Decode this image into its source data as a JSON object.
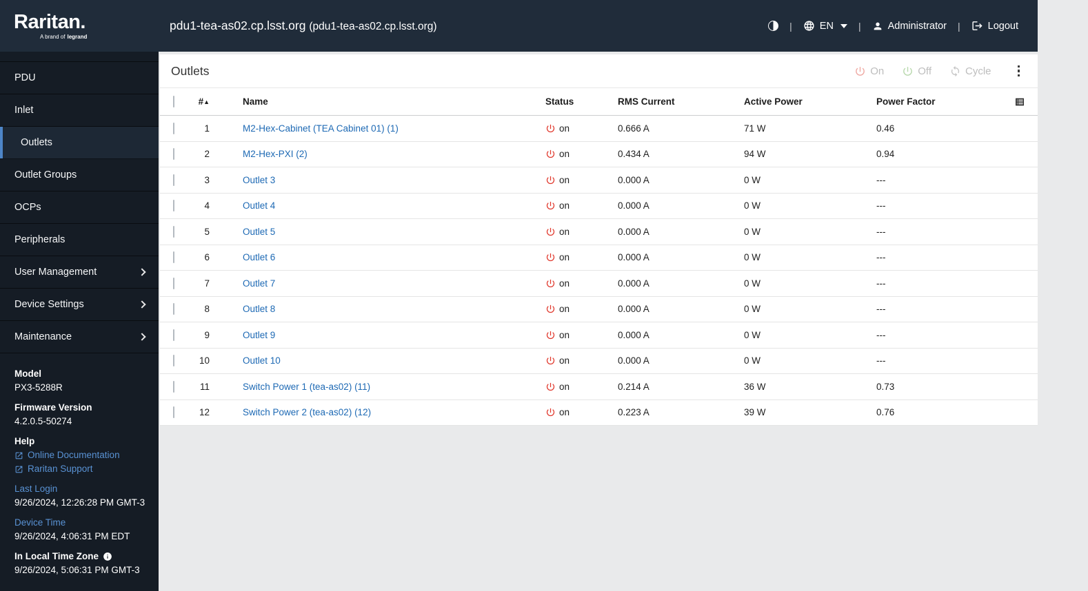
{
  "header": {
    "brand": "Raritan.",
    "tagline_prefix": "A brand of",
    "tagline_brand": "legrand",
    "hostname": "pdu1-tea-as02.cp.lsst.org",
    "hostname_paren": "(pdu1-tea-as02.cp.lsst.org)",
    "language": "EN",
    "user": "Administrator",
    "logout_label": "Logout",
    "separator": "|"
  },
  "sidebar": {
    "items": [
      {
        "label": "PDU",
        "active": false,
        "expandable": false
      },
      {
        "label": "Inlet",
        "active": false,
        "expandable": false
      },
      {
        "label": "Outlets",
        "active": true,
        "expandable": false
      },
      {
        "label": "Outlet Groups",
        "active": false,
        "expandable": false
      },
      {
        "label": "OCPs",
        "active": false,
        "expandable": false
      },
      {
        "label": "Peripherals",
        "active": false,
        "expandable": false
      },
      {
        "label": "User Management",
        "active": false,
        "expandable": true
      },
      {
        "label": "Device Settings",
        "active": false,
        "expandable": true
      },
      {
        "label": "Maintenance",
        "active": false,
        "expandable": true
      }
    ],
    "info": {
      "model_label": "Model",
      "model_value": "PX3-5288R",
      "firmware_label": "Firmware Version",
      "firmware_value": "4.2.0.5-50274",
      "help_label": "Help",
      "links": [
        {
          "label": "Online Documentation"
        },
        {
          "label": "Raritan Support"
        }
      ],
      "last_login_label": "Last Login",
      "last_login_value": "9/26/2024, 12:26:28 PM GMT-3",
      "device_time_label": "Device Time",
      "device_time_value": "9/26/2024, 4:06:31 PM EDT",
      "local_tz_label": "In Local Time Zone",
      "local_tz_value": "9/26/2024, 5:06:31 PM GMT-3"
    }
  },
  "main": {
    "title": "Outlets",
    "actions": {
      "on": "On",
      "off": "Off",
      "cycle": "Cycle"
    },
    "table": {
      "columns": {
        "num": "#",
        "name": "Name",
        "status": "Status",
        "rms": "RMS Current",
        "power": "Active Power",
        "pf": "Power Factor"
      },
      "rows": [
        {
          "num": "1",
          "name": "M2-Hex-Cabinet (TEA Cabinet 01) (1)",
          "status": "on",
          "rms": "0.666 A",
          "power": "71 W",
          "pf": "0.46"
        },
        {
          "num": "2",
          "name": "M2-Hex-PXI (2)",
          "status": "on",
          "rms": "0.434 A",
          "power": "94 W",
          "pf": "0.94"
        },
        {
          "num": "3",
          "name": "Outlet 3",
          "status": "on",
          "rms": "0.000 A",
          "power": "0 W",
          "pf": "---"
        },
        {
          "num": "4",
          "name": "Outlet 4",
          "status": "on",
          "rms": "0.000 A",
          "power": "0 W",
          "pf": "---"
        },
        {
          "num": "5",
          "name": "Outlet 5",
          "status": "on",
          "rms": "0.000 A",
          "power": "0 W",
          "pf": "---"
        },
        {
          "num": "6",
          "name": "Outlet 6",
          "status": "on",
          "rms": "0.000 A",
          "power": "0 W",
          "pf": "---"
        },
        {
          "num": "7",
          "name": "Outlet 7",
          "status": "on",
          "rms": "0.000 A",
          "power": "0 W",
          "pf": "---"
        },
        {
          "num": "8",
          "name": "Outlet 8",
          "status": "on",
          "rms": "0.000 A",
          "power": "0 W",
          "pf": "---"
        },
        {
          "num": "9",
          "name": "Outlet 9",
          "status": "on",
          "rms": "0.000 A",
          "power": "0 W",
          "pf": "---"
        },
        {
          "num": "10",
          "name": "Outlet 10",
          "status": "on",
          "rms": "0.000 A",
          "power": "0 W",
          "pf": "---"
        },
        {
          "num": "11",
          "name": "Switch Power 1 (tea-as02) (11)",
          "status": "on",
          "rms": "0.214 A",
          "power": "36 W",
          "pf": "0.73"
        },
        {
          "num": "12",
          "name": "Switch Power 2 (tea-as02) (12)",
          "status": "on",
          "rms": "0.223 A",
          "power": "39 W",
          "pf": "0.76"
        }
      ]
    }
  },
  "colors": {
    "topbar_bg": "#202c3a",
    "sidebar_bg": "#151c25",
    "active_accent": "#4d85c7",
    "table_link": "#1d69b4",
    "sidebar_link": "#5992d4",
    "status_on_red": "#e0362a",
    "action_on_pink": "#efaaa4",
    "action_off_green": "#b9d9ae"
  }
}
